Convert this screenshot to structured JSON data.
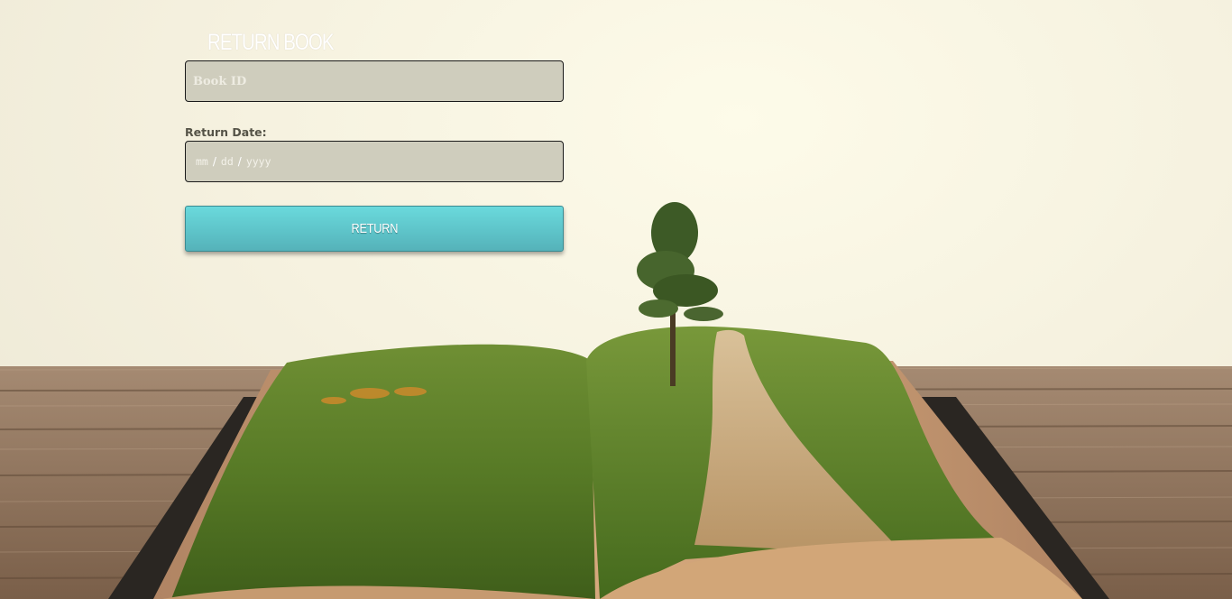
{
  "form": {
    "title": "RETURN BOOK",
    "book_id": {
      "placeholder": "Book ID",
      "value": ""
    },
    "return_date": {
      "label": "Return Date:",
      "month_placeholder": "mm",
      "day_placeholder": "dd",
      "year_placeholder": "yyyy",
      "separator": "/"
    },
    "submit_label": "RETURN"
  },
  "colors": {
    "button_top": "#6ad9dc",
    "button_bottom": "#55b2b9",
    "field_background": "#cfcdbd",
    "sky": "#f6f2e0",
    "wood": "#8a6e57",
    "grass": "#5a7a2a",
    "path": "#c9a87a"
  },
  "background": {
    "icons": [
      "open-book-landscape-illustration",
      "tree-icon",
      "dirt-path"
    ]
  }
}
